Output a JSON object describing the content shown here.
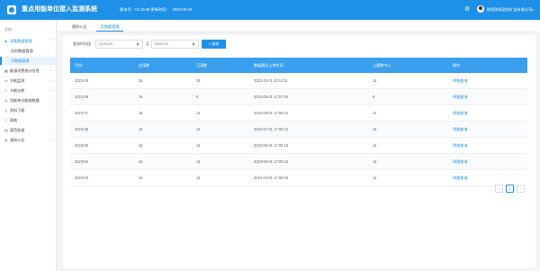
{
  "header": {
    "title": "重点用能单位接入监测系统",
    "version_label": "版本号：V2.15.56 更新时间：",
    "update_date": "2023-09-26",
    "user_name": "陕西陕煤澄合矿业有限公司",
    "icons": [
      "logo-icon",
      "gear-icon",
      "avatar",
      "caret-down-icon"
    ]
  },
  "sidebar": {
    "nav_title": "导航",
    "items": [
      {
        "label": "采集数据管理",
        "icon": "tag-icon",
        "arrow": "⌃"
      },
      {
        "label": "实时数据管理",
        "icon": "",
        "arrow": ""
      },
      {
        "label": "月数据管理",
        "icon": "",
        "arrow": ""
      },
      {
        "label": "能源消费统计信息",
        "icon": "grid-icon",
        "arrow": "⌄"
      },
      {
        "label": "节能监测",
        "icon": "monitor-icon",
        "arrow": "⌄"
      },
      {
        "label": "节能诊断",
        "icon": "stethoscope-icon",
        "arrow": "⌄"
      },
      {
        "label": "用能单位能耗数据",
        "icon": "database-icon",
        "arrow": "⌄"
      },
      {
        "label": "资料下载",
        "icon": "download-icon",
        "arrow": "⌄"
      },
      {
        "label": "帮助",
        "icon": "help-icon",
        "arrow": ""
      },
      {
        "label": "规范依据",
        "icon": "book-icon",
        "arrow": "⌄"
      },
      {
        "label": "通知公告",
        "icon": "chat-icon",
        "arrow": "⌄"
      }
    ]
  },
  "tabs": [
    {
      "label": "通知公告"
    },
    {
      "label": "月数据管理"
    }
  ],
  "filter": {
    "label": "查询时间段",
    "start_value": "2023-03",
    "separator": "至",
    "end_value": "2023-09",
    "query_button": "查询",
    "calendar_icon": "calendar-icon",
    "search_icon": "search-icon"
  },
  "table": {
    "columns": [
      "月份",
      "应采数",
      "已采数",
      "数据最后上传时间",
      "上报数中心",
      "操作"
    ],
    "rows": [
      {
        "month": "2023-09",
        "expected": "16",
        "collected": "14",
        "last_upload": "2023-10-01 10:14:11",
        "reported": "14",
        "action": "明细查询"
      },
      {
        "month": "2023-08",
        "expected": "16",
        "collected": "8",
        "last_upload": "2023-09-01 17:07:06",
        "reported": "8",
        "action": "明细查询"
      },
      {
        "month": "2023-07",
        "expected": "16",
        "collected": "14",
        "last_upload": "2023-08-01 17:09:13",
        "reported": "14",
        "action": "明细查询"
      },
      {
        "month": "2023-06",
        "expected": "16",
        "collected": "14",
        "last_upload": "2023-07-01 17:09:13",
        "reported": "14",
        "action": "明细查询"
      },
      {
        "month": "2023-05",
        "expected": "16",
        "collected": "14",
        "last_upload": "2023-06-01 17:09:13",
        "reported": "14",
        "action": "明细查询"
      },
      {
        "month": "2023-04",
        "expected": "16",
        "collected": "14",
        "last_upload": "2023-05-01 17:09:13",
        "reported": "14",
        "action": "明细查询"
      },
      {
        "month": "2023-03",
        "expected": "16",
        "collected": "14",
        "last_upload": "2023-04-01 17:08:08",
        "reported": "14",
        "action": "明细查询"
      }
    ]
  },
  "pagination": {
    "prev": "‹",
    "current": "1",
    "next": "›"
  },
  "colors": {
    "primary": "#1f90e8",
    "table_header": "#3aa0ee"
  }
}
